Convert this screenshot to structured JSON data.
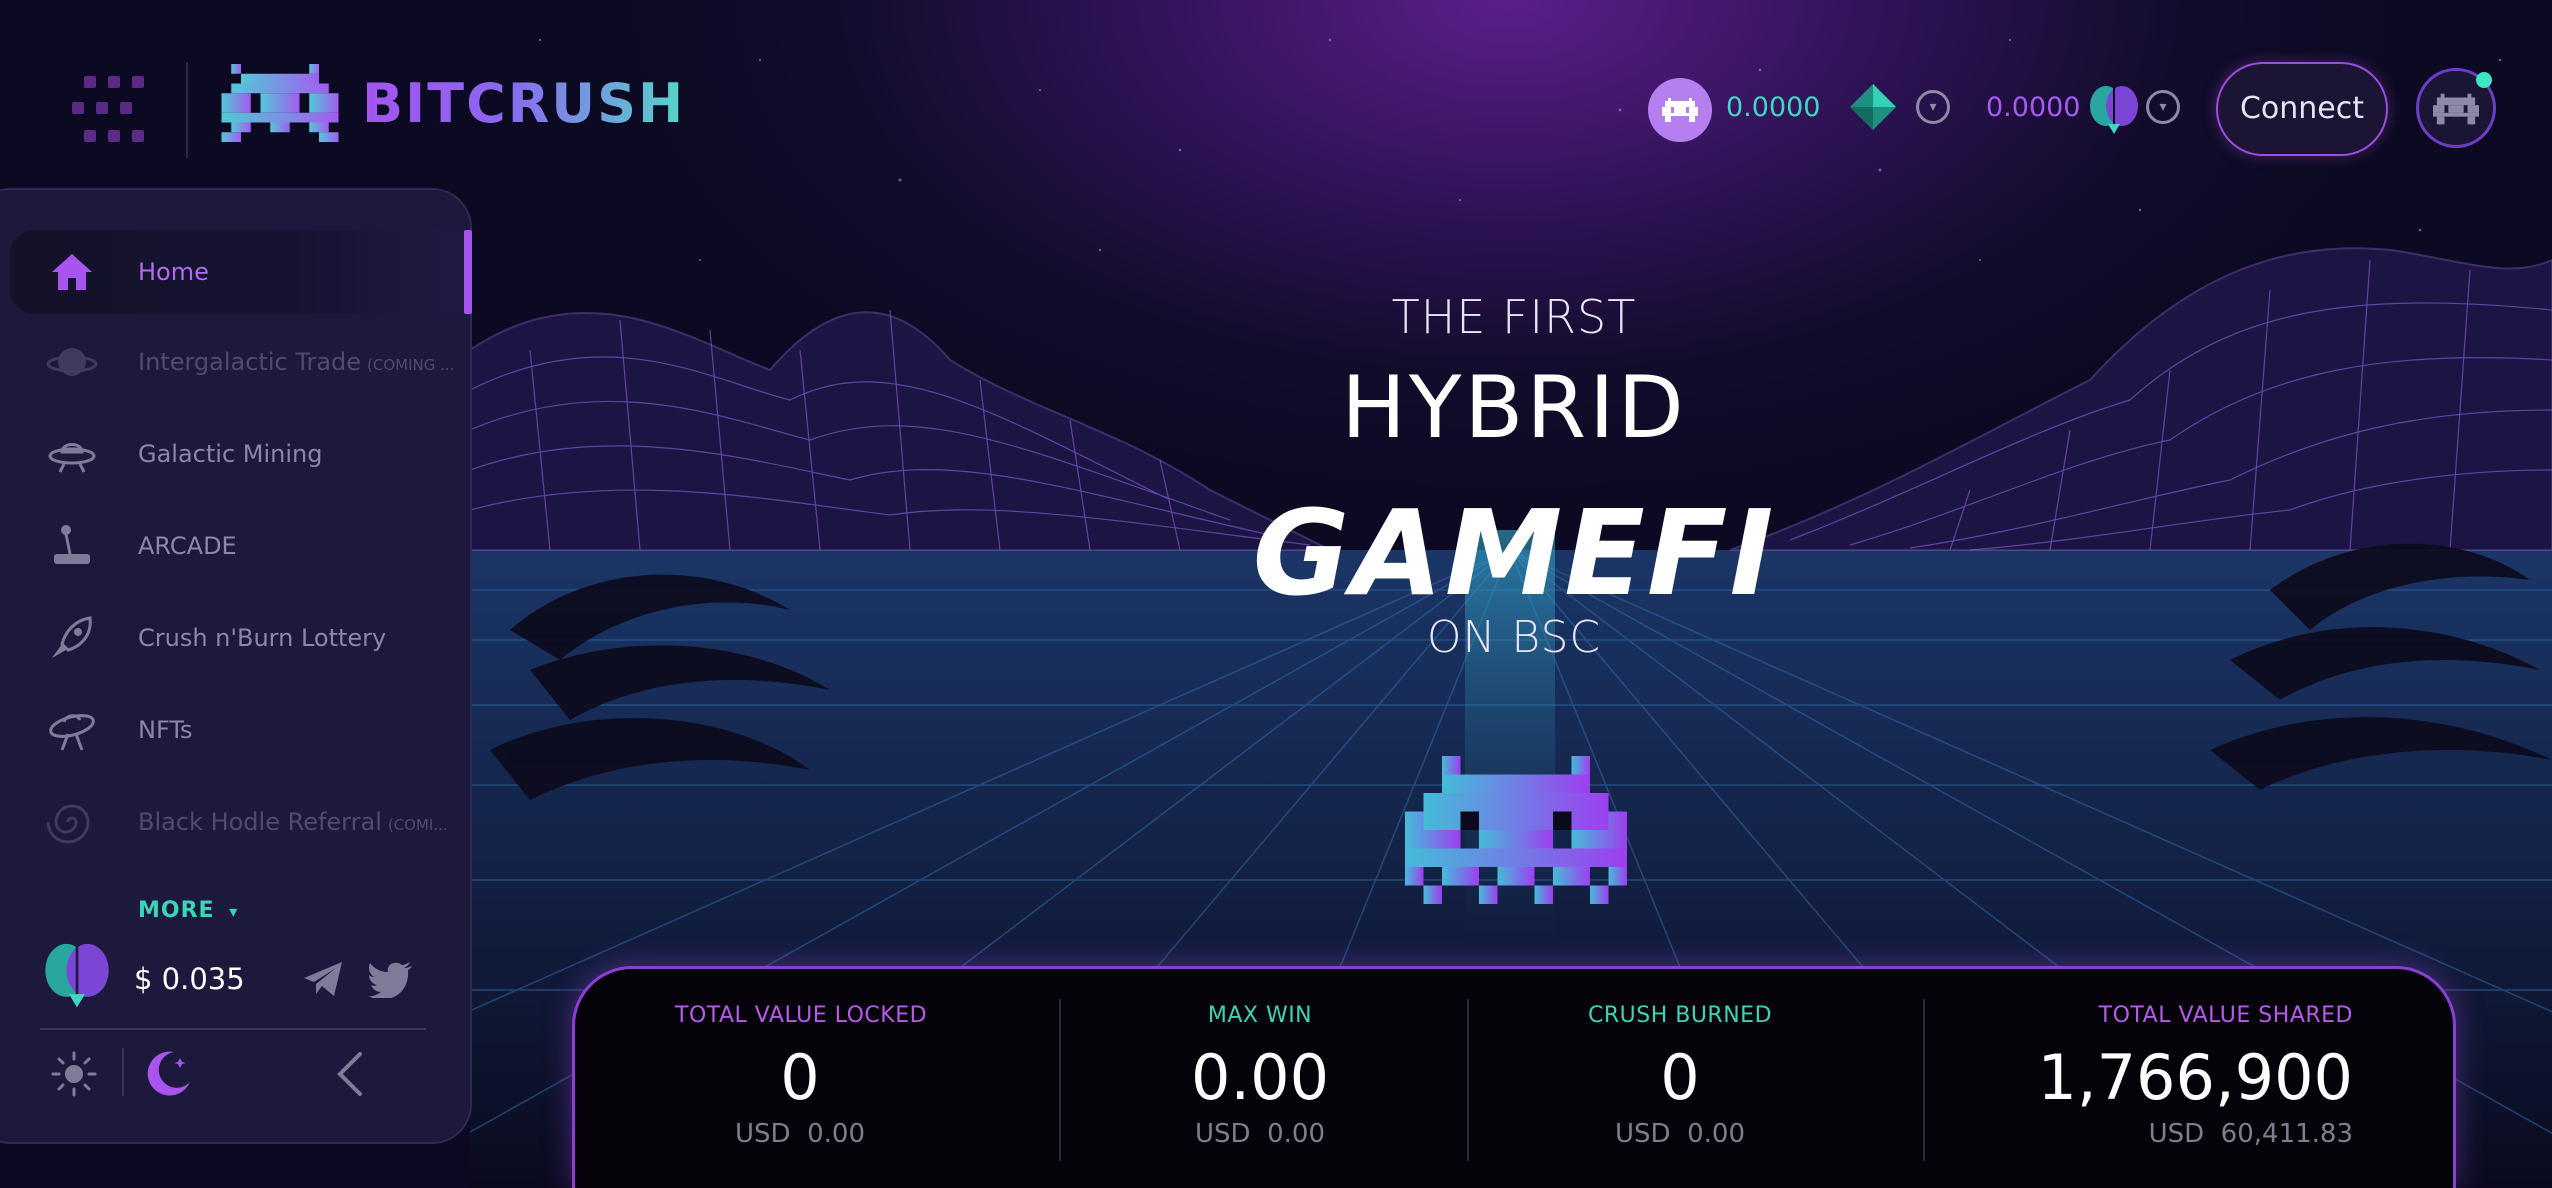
{
  "brand": {
    "name": "BITCRUSH"
  },
  "header": {
    "crush_balance": "0.0000",
    "bank_balance": "0.0000",
    "connect_label": "Connect"
  },
  "sidebar": {
    "items": [
      {
        "label": "Home",
        "icon": "home-icon",
        "active": true
      },
      {
        "label": "Intergalactic Trade",
        "tag": "(COMING ...",
        "icon": "planet-icon",
        "disabled": true
      },
      {
        "label": "Galactic Mining",
        "icon": "ufo-icon"
      },
      {
        "label": "ARCADE",
        "icon": "joystick-icon"
      },
      {
        "label": "Crush n'Burn Lottery",
        "icon": "rocket-icon"
      },
      {
        "label": "NFTs",
        "icon": "spaceship-icon"
      },
      {
        "label": "Black Hodle Referral",
        "tag": "(COMI...",
        "icon": "black-hole-icon",
        "disabled": true
      }
    ],
    "more_label": "MORE",
    "token_price": "$ 0.035"
  },
  "hero": {
    "line1": "THE FIRST",
    "line2": "HYBRID",
    "line3": "GAMEFI",
    "line4": "ON BSC"
  },
  "stats": [
    {
      "label": "TOTAL VALUE LOCKED",
      "value": "0",
      "usd_prefix": "USD",
      "usd": "0.00",
      "color": "#b45ce8"
    },
    {
      "label": "MAX WIN",
      "value": "0.00",
      "usd_prefix": "USD",
      "usd": "0.00",
      "color": "#3fd3b5"
    },
    {
      "label": "CRUSH BURNED",
      "value": "0",
      "usd_prefix": "USD",
      "usd": "0.00",
      "color": "#3fd3b5"
    },
    {
      "label": "TOTAL VALUE SHARED",
      "value": "1,766,900",
      "usd_prefix": "USD",
      "usd": "60,411.83",
      "color": "#b45ce8"
    }
  ],
  "colors": {
    "accent_purple": "#a855f0",
    "accent_teal": "#3ad5b8",
    "background": "#0c0a22"
  }
}
